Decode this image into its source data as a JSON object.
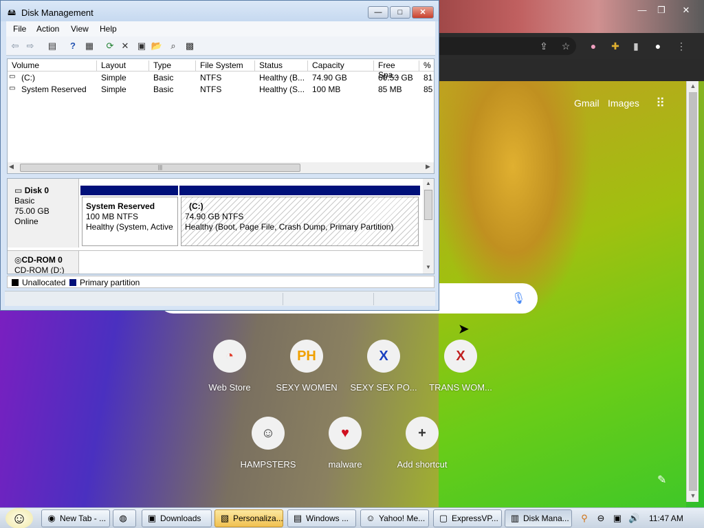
{
  "chrome": {
    "top_links": [
      "Gmail",
      "Images"
    ],
    "shortcuts": [
      {
        "label": "Web Store",
        "icon": "web-store-icon",
        "glyph": "◔",
        "color": "#e04030"
      },
      {
        "label": "SEXY WOMEN",
        "icon": "ph-icon",
        "glyph": "PH",
        "color": "#f0a000"
      },
      {
        "label": "SEXY SEX PO...",
        "icon": "x-blue-icon",
        "glyph": "X",
        "color": "#1a40c0"
      },
      {
        "label": "TRANS WOM...",
        "icon": "x-red-icon",
        "glyph": "X",
        "color": "#c02020"
      },
      {
        "label": "HAMPSTERS",
        "icon": "hamster-icon",
        "glyph": "☺",
        "color": "#333333"
      },
      {
        "label": "malware",
        "icon": "heart-icon",
        "glyph": "♥",
        "color": "#d01020"
      },
      {
        "label": "Add shortcut",
        "icon": "plus-icon",
        "glyph": "+",
        "color": "#333333"
      }
    ]
  },
  "dm": {
    "title": "Disk Management",
    "menu": [
      "File",
      "Action",
      "View",
      "Help"
    ],
    "columns": [
      "Volume",
      "Layout",
      "Type",
      "File System",
      "Status",
      "Capacity",
      "Free Spa...",
      "% F"
    ],
    "rows": [
      [
        "(C:)",
        "Simple",
        "Basic",
        "NTFS",
        "Healthy (B...",
        "74.90 GB",
        "60.53 GB",
        "81"
      ],
      [
        "System Reserved",
        "Simple",
        "Basic",
        "NTFS",
        "Healthy (S...",
        "100 MB",
        "85 MB",
        "85"
      ]
    ],
    "disk0": {
      "name": "Disk 0",
      "type": "Basic",
      "size": "75.00 GB",
      "state": "Online",
      "part1": {
        "title": "System Reserved",
        "size": "100 MB NTFS",
        "status": "Healthy (System, Active,"
      },
      "part2": {
        "title": "(C:)",
        "size": "74.90 GB NTFS",
        "status": "Healthy (Boot, Page File, Crash Dump, Primary Partition)"
      }
    },
    "cdrom": {
      "name": "CD-ROM 0",
      "drive": "CD-ROM (D:)"
    },
    "legend": [
      {
        "label": "Unallocated",
        "color": "#000000"
      },
      {
        "label": "Primary partition",
        "color": "#00107a"
      }
    ]
  },
  "taskbar": {
    "tasks": [
      {
        "label": "New Tab - ...",
        "icon": "chrome-icon",
        "state": "normal"
      },
      {
        "label": "",
        "icon": "firefox-icon",
        "state": "normal"
      },
      {
        "label": "Downloads",
        "icon": "downloads-icon",
        "state": "normal"
      },
      {
        "label": "Personaliza...",
        "icon": "personalization-icon",
        "state": "active"
      },
      {
        "label": "Windows ...",
        "icon": "windows-icon",
        "state": "normal"
      },
      {
        "label": "Yahoo! Me...",
        "icon": "yahoo-icon",
        "state": "normal"
      },
      {
        "label": "ExpressVP...",
        "icon": "expressvpn-icon",
        "state": "normal"
      },
      {
        "label": "Disk Mana...",
        "icon": "disk-management-icon",
        "state": "pressed"
      }
    ],
    "clock": "11:47 AM"
  }
}
